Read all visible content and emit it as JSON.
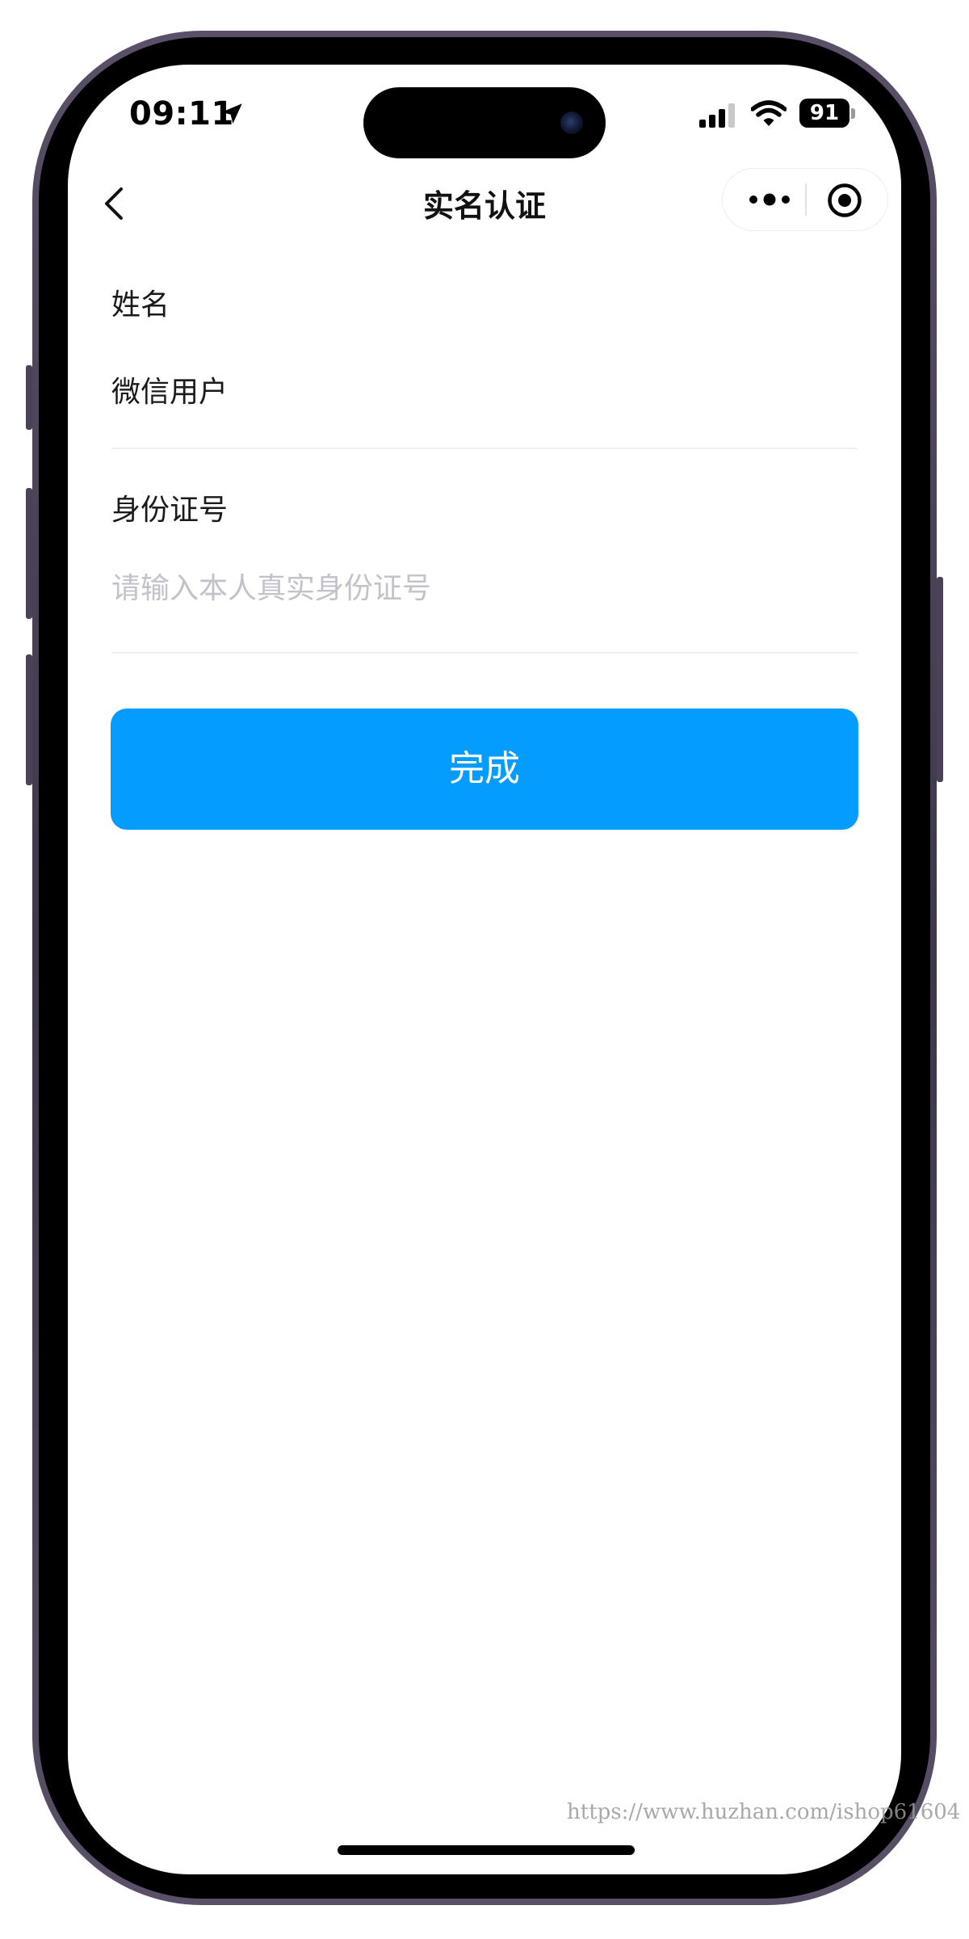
{
  "status_bar": {
    "time": "09:11",
    "battery": "91",
    "location_icon": "location-arrow-icon",
    "signal_icon": "cellular-signal-icon",
    "wifi_icon": "wifi-icon"
  },
  "nav": {
    "title": "实名认证",
    "back_icon": "chevron-left-icon",
    "more_icon": "more-dots-icon",
    "close_icon": "target-close-icon"
  },
  "form": {
    "name_label": "姓名",
    "name_value": "微信用户",
    "id_label": "身份证号",
    "id_value": "",
    "id_placeholder": "请输入本人真实身份证号"
  },
  "submit": {
    "label": "完成"
  },
  "colors": {
    "accent": "#049cff",
    "placeholder": "#c2c2ca",
    "divider": "#efefef"
  },
  "watermark": "https://www.huzhan.com/ishop61604"
}
